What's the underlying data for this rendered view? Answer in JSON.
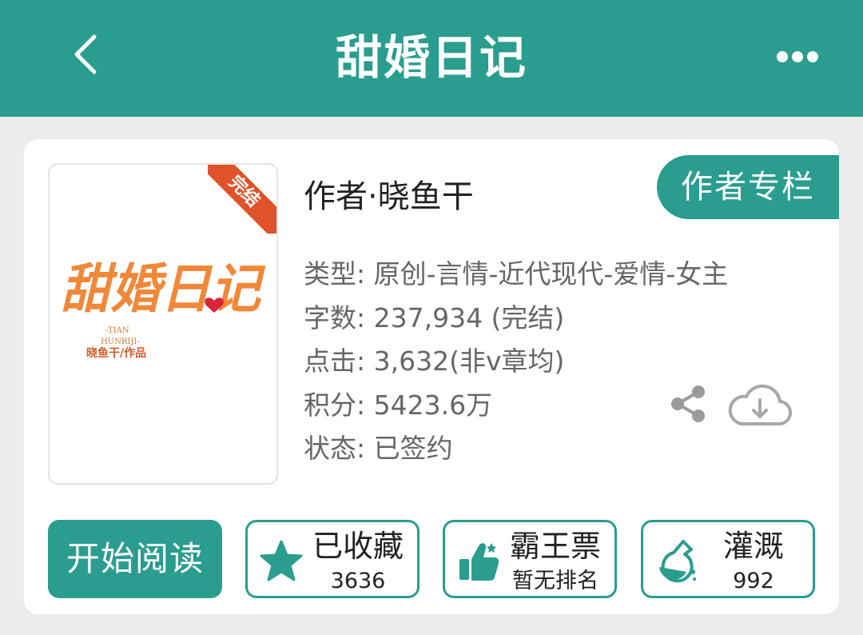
{
  "header": {
    "title": "甜婚日记",
    "back_icon": "chevron-left-icon",
    "more_icon": "more-dots-icon"
  },
  "book": {
    "cover": {
      "ribbon_text": "完结",
      "title_art": "甜婚日记",
      "subtitle_line1": "-TIAN",
      "subtitle_line2": "HUNRIJI-",
      "byline": "晓鱼干/作品"
    },
    "author_line": "作者·晓鱼干",
    "author_column_label": "作者专栏",
    "meta": [
      "类型: 原创-言情-近代现代-爱情-女主",
      "字数: 237,934 (完结)",
      "点击: 3,632(非v章均)",
      "积分: 5423.6万",
      "状态: 已签约"
    ]
  },
  "actions": {
    "read_label": "开始阅读",
    "favorite": {
      "label": "已收藏",
      "value": "3636",
      "icon": "star-icon"
    },
    "vote": {
      "label": "霸王票",
      "value": "暂无排名",
      "icon": "thumbs-up-icon"
    },
    "nutrient": {
      "label": "灌溉",
      "value": "992",
      "icon": "flask-icon"
    }
  },
  "icons": {
    "share": "share-icon",
    "download": "cloud-download-icon"
  },
  "colors": {
    "accent": "#2a9d8f",
    "ribbon": "#e0522a",
    "cover_art": "#f0883a"
  }
}
